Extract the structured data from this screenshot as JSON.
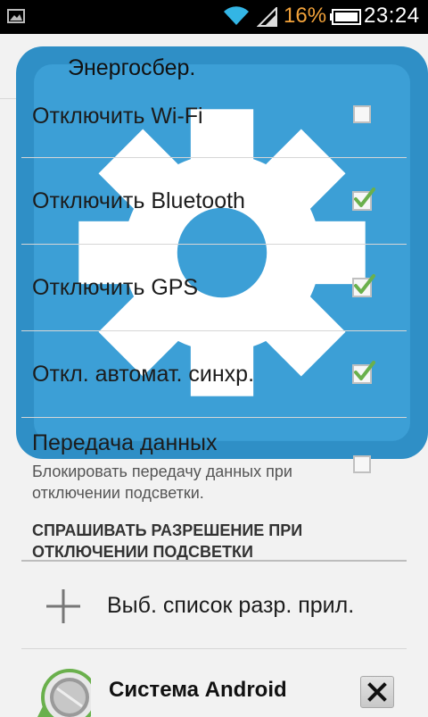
{
  "status_bar": {
    "battery_percent": "16%",
    "time": "23:24",
    "icons": [
      "gallery-icon",
      "wifi-icon",
      "signal-icon",
      "battery-icon"
    ]
  },
  "action_bar": {
    "title": "Энергосбер.",
    "icon": "settings-gear-icon"
  },
  "preferences": [
    {
      "title": "Отключить Wi-Fi",
      "checked": false
    },
    {
      "title": "Отключить Bluetooth",
      "checked": true
    },
    {
      "title": "Отключить GPS",
      "checked": true
    },
    {
      "title": "Откл. автомат. синхр.",
      "checked": true
    },
    {
      "title": "Передача данных",
      "summary": "Блокировать передачу данных при отключении подсветки.",
      "checked": false
    }
  ],
  "category": "СПРАШИВАТЬ РАЗРЕШЕНИЕ ПРИ ОТКЛЮЧЕНИИ ПОДСВЕТКИ",
  "add_item": {
    "label": "Выб. список разр. прил.",
    "icon": "plus-icon"
  },
  "apps": [
    {
      "name": "Система Android",
      "icon": "android-system-icon",
      "action_icon": "close-icon"
    }
  ],
  "colors": {
    "check": "#6ab04c",
    "battery_text": "#f2a23a",
    "status_bar_bg": "#000000",
    "background": "#f2f2f2"
  }
}
